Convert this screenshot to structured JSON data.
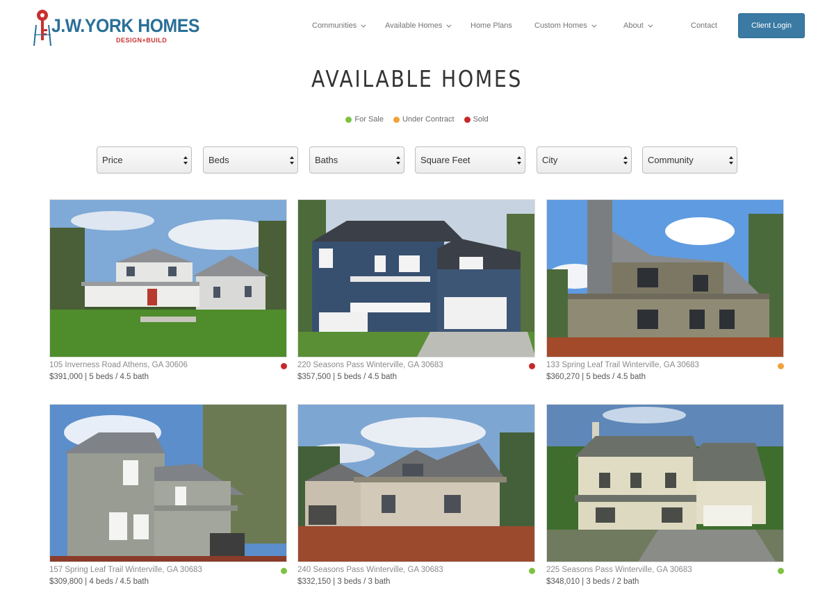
{
  "brand": {
    "name": "J.W.YORK HOMES",
    "tagline": "DESIGN+BUILD"
  },
  "nav": {
    "items": [
      {
        "label": "Communities",
        "has_dropdown": true
      },
      {
        "label": "Available Homes",
        "has_dropdown": true
      },
      {
        "label": "Home Plans",
        "has_dropdown": false
      },
      {
        "label": "Custom Homes",
        "has_dropdown": true
      },
      {
        "label": "About",
        "has_dropdown": true
      },
      {
        "label": "Contact",
        "has_dropdown": false
      }
    ],
    "login_label": "Client Login"
  },
  "page": {
    "title": "AVAILABLE HOMES"
  },
  "legend": [
    {
      "label": "For Sale",
      "color": "#7dc242"
    },
    {
      "label": "Under Contract",
      "color": "#f0a23a"
    },
    {
      "label": "Sold",
      "color": "#c62828"
    }
  ],
  "filters": [
    {
      "label": "Price"
    },
    {
      "label": "Beds"
    },
    {
      "label": "Baths"
    },
    {
      "label": "Square Feet"
    },
    {
      "label": "City"
    },
    {
      "label": "Community"
    }
  ],
  "listings": [
    {
      "address": "105 Inverness Road Athens, GA 30606",
      "details": "$391,000 | 5 beds / 4.5 bath",
      "status": "Sold",
      "status_color": "#c62828"
    },
    {
      "address": "220 Seasons Pass Winterville, GA 30683",
      "details": "$357,500 | 5 beds / 4.5 bath",
      "status": "Sold",
      "status_color": "#c62828"
    },
    {
      "address": "133 Spring Leaf Trail Winterville, GA 30683",
      "details": "$360,270 | 5 beds / 4.5 bath",
      "status": "Under Contract",
      "status_color": "#f0a23a"
    },
    {
      "address": "157 Spring Leaf Trail Winterville, GA 30683",
      "details": "$309,800 | 4 beds / 4.5 bath",
      "status": "For Sale",
      "status_color": "#7dc242"
    },
    {
      "address": "240 Seasons Pass Winterville, GA 30683",
      "details": "$332,150 | 3 beds / 3 bath",
      "status": "For Sale",
      "status_color": "#7dc242"
    },
    {
      "address": "225 Seasons Pass Winterville, GA 30683",
      "details": "$348,010 | 3 beds / 2 bath",
      "status": "For Sale",
      "status_color": "#7dc242"
    }
  ],
  "colors": {
    "brand_blue": "#2a6f97",
    "brand_red": "#c8302f",
    "button": "#3a7aa3"
  }
}
